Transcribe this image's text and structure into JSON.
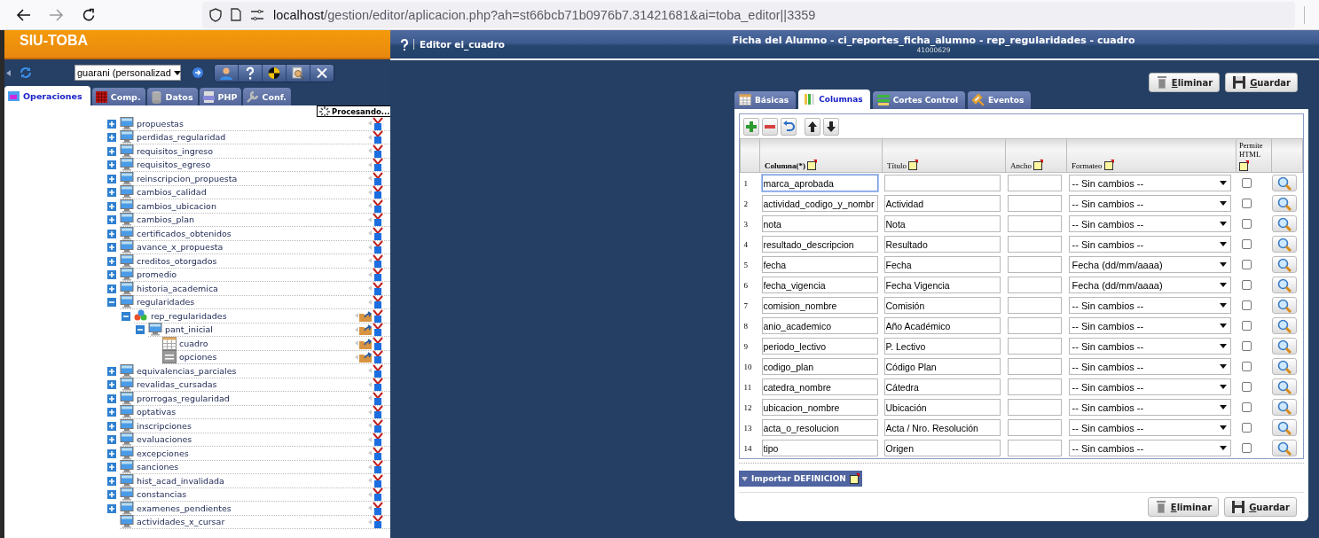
{
  "browser": {
    "url_host": "localhost",
    "url_path": "/gestion/editor/aplicacion.php?ah=st66bcb71b0976b7.31421681&ai=toba_editor||3359"
  },
  "sidebar": {
    "brand": "SIU-TOBA",
    "project_select": {
      "value": "guarani (personalizad"
    },
    "tabs": [
      {
        "label": "Operaciones",
        "kind": "operations",
        "selected": true
      },
      {
        "label": "Comp.",
        "kind": "components",
        "selected": false
      },
      {
        "label": "Datos",
        "kind": "data",
        "selected": false
      },
      {
        "label": "PHP",
        "kind": "php",
        "selected": false
      },
      {
        "label": "Conf.",
        "kind": "config",
        "selected": false
      }
    ],
    "status_popup": "Procesando...",
    "tree": [
      {
        "label": "propuestas",
        "kind": "screen",
        "expanded": false
      },
      {
        "label": "perdidas_regularidad",
        "kind": "screen",
        "expanded": false
      },
      {
        "label": "requisitos_ingreso",
        "kind": "screen",
        "expanded": false
      },
      {
        "label": "requisitos_egreso",
        "kind": "screen",
        "expanded": false
      },
      {
        "label": "reinscripcion_propuesta",
        "kind": "screen",
        "expanded": false
      },
      {
        "label": "cambios_calidad",
        "kind": "screen",
        "expanded": false
      },
      {
        "label": "cambios_ubicacion",
        "kind": "screen",
        "expanded": false
      },
      {
        "label": "cambios_plan",
        "kind": "screen",
        "expanded": false
      },
      {
        "label": "certificados_obtenidos",
        "kind": "screen",
        "expanded": false
      },
      {
        "label": "avance_x_propuesta",
        "kind": "screen",
        "expanded": false
      },
      {
        "label": "creditos_otorgados",
        "kind": "screen",
        "expanded": false
      },
      {
        "label": "promedio",
        "kind": "screen",
        "expanded": false
      },
      {
        "label": "historia_academica",
        "kind": "screen",
        "expanded": false
      },
      {
        "label": "regularidades",
        "kind": "screen",
        "expanded": true,
        "children": [
          {
            "label": "rep_regularidades",
            "kind": "ci",
            "expanded": true,
            "children": [
              {
                "label": "pant_inicial",
                "kind": "screen",
                "expanded": true,
                "children": [
                  {
                    "label": "cuadro",
                    "kind": "table"
                  },
                  {
                    "label": "opciones",
                    "kind": "form"
                  }
                ]
              }
            ]
          }
        ]
      },
      {
        "label": "equivalencias_parciales",
        "kind": "screen",
        "expanded": false
      },
      {
        "label": "revalidas_cursadas",
        "kind": "screen",
        "expanded": false
      },
      {
        "label": "prorrogas_regularidad",
        "kind": "screen",
        "expanded": false
      },
      {
        "label": "optativas",
        "kind": "screen",
        "expanded": false
      },
      {
        "label": "inscripciones",
        "kind": "screen",
        "expanded": false
      },
      {
        "label": "evaluaciones",
        "kind": "screen",
        "expanded": false
      },
      {
        "label": "excepciones",
        "kind": "screen",
        "expanded": false
      },
      {
        "label": "sanciones",
        "kind": "screen",
        "expanded": false
      },
      {
        "label": "hist_acad_invalidada",
        "kind": "screen",
        "expanded": false
      },
      {
        "label": "constancias",
        "kind": "screen",
        "expanded": false
      },
      {
        "label": "examenes_pendientes",
        "kind": "screen",
        "expanded": false
      },
      {
        "label": "actividades_x_cursar",
        "kind": "screen"
      }
    ]
  },
  "editor": {
    "title": "Editor ei_cuadro",
    "heading": "Ficha del Alumno - ci_reportes_ficha_alumno - rep_regularidades - cuadro",
    "subheading": "41000629",
    "top_buttons": [
      {
        "label": "Eliminar",
        "kind": "delete"
      },
      {
        "label": "Guardar",
        "kind": "save"
      }
    ],
    "tabs": [
      {
        "label": "Básicas",
        "kind": "basic",
        "selected": false
      },
      {
        "label": "Columnas",
        "kind": "columns",
        "selected": true
      },
      {
        "label": "Cortes Control",
        "kind": "breaks",
        "selected": false
      },
      {
        "label": "Eventos",
        "kind": "events",
        "selected": false
      }
    ],
    "table": {
      "columns": [
        "Columna(*)",
        "Título",
        "Ancho",
        "Formateo",
        "Permite HTML"
      ],
      "rows": [
        {
          "number": "1",
          "columna": "marca_aprobada",
          "focused": true,
          "formateo": "-- Sin cambios --",
          "permite_html": false
        },
        {
          "number": "2",
          "columna": "actividad_codigo_y_nombr",
          "titulo": "Actividad",
          "focused": false,
          "formateo": "-- Sin cambios --",
          "permite_html": false
        },
        {
          "number": "3",
          "columna": "nota",
          "titulo": "Nota",
          "focused": false,
          "formateo": "-- Sin cambios --",
          "permite_html": false
        },
        {
          "number": "4",
          "columna": "resultado_descripcion",
          "titulo": "Resultado",
          "focused": false,
          "formateo": "-- Sin cambios --",
          "permite_html": false
        },
        {
          "number": "5",
          "columna": "fecha",
          "titulo": "Fecha",
          "focused": false,
          "formateo": "Fecha (dd/mm/aaaa)",
          "permite_html": false
        },
        {
          "number": "6",
          "columna": "fecha_vigencia",
          "titulo": "Fecha Vigencia",
          "focused": false,
          "formateo": "Fecha (dd/mm/aaaa)",
          "permite_html": false
        },
        {
          "number": "7",
          "columna": "comision_nombre",
          "titulo": "Comisión",
          "focused": false,
          "formateo": "-- Sin cambios --",
          "permite_html": false
        },
        {
          "number": "8",
          "columna": "anio_academico",
          "titulo": "Año Académico",
          "focused": false,
          "formateo": "-- Sin cambios --",
          "permite_html": false
        },
        {
          "number": "9",
          "columna": "periodo_lectivo",
          "titulo": "P. Lectivo",
          "focused": false,
          "formateo": "-- Sin cambios --",
          "permite_html": false
        },
        {
          "number": "10",
          "columna": "codigo_plan",
          "titulo": "Código Plan",
          "focused": false,
          "formateo": "-- Sin cambios --",
          "permite_html": false
        },
        {
          "number": "11",
          "columna": "catedra_nombre",
          "titulo": "Cátedra",
          "focused": false,
          "formateo": "-- Sin cambios --",
          "permite_html": false
        },
        {
          "number": "12",
          "columna": "ubicacion_nombre",
          "titulo": "Ubicación",
          "focused": false,
          "formateo": "-- Sin cambios --",
          "permite_html": false
        },
        {
          "number": "13",
          "columna": "acta_o_resolucion",
          "titulo": "Acta / Nro. Resolución",
          "focused": false,
          "formateo": "-- Sin cambios --",
          "permite_html": false
        },
        {
          "number": "14",
          "columna": "tipo",
          "titulo": "Origen",
          "focused": false,
          "formateo": "-- Sin cambios --",
          "permite_html": false
        }
      ]
    },
    "import_button": "Importar DEFINICION",
    "bottom_buttons": [
      {
        "label": "Eliminar",
        "kind": "delete"
      },
      {
        "label": "Guardar",
        "kind": "save"
      }
    ]
  }
}
